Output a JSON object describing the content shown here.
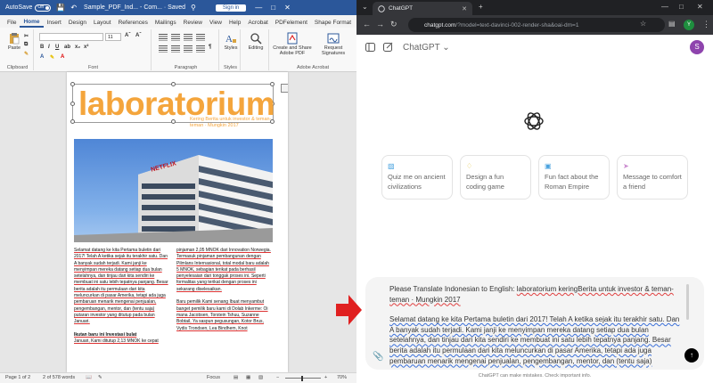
{
  "word": {
    "autosave_label": "AutoSave",
    "autosave_state": "Off",
    "doc_title": "Sample_PDF_Ind... - Com... · Saved",
    "signin_label": "Sign in",
    "tabs": [
      "File",
      "Home",
      "Insert",
      "Design",
      "Layout",
      "References",
      "Mailings",
      "Review",
      "View",
      "Help",
      "Acrobat",
      "PDFelement",
      "Shape Format"
    ],
    "active_tab": "Home",
    "ribbon": {
      "paste_label": "Paste",
      "clipboard_label": "Clipboard",
      "font_label": "Font",
      "paragraph_label": "Paragraph",
      "styles_label": "Styles",
      "editing_label": "Editing",
      "create_share_label": "Create and Share Adobe PDF",
      "request_sig_label": "Request Signatures",
      "adobe_label": "Adobe Acrobat",
      "font_size": "11"
    },
    "page": {
      "title_word": "laboratorium",
      "subtitle": "Kering Berita untuk investor & teman-teman · Mungkin 2017",
      "col1": "Selamat datang ke kita Pertama buletin dari 2017! Telah A ketika sejak itu terakhir satu. Dan A banyak sudah terjadi. Kami janji ke menyimpan mereka datang setiap dua bulan setelahnya, dan tinjau dari kita sendiri ke membuat ini satu lebih tepatnya panjang. Besar berita adalah itu permulaan dari kita meluncurkan di pasar Amerika, tetapi ada juga pembaruan menarik mengenai penjualan, pengembangan, mentor, dan (tentu saja) putaran investor yang ditutup pada bulan Januari.",
      "col1_heading": "Ikutan baru ini Investasi bulat",
      "col1_tail": "Januari, Kami ditutup 2,13 MNOK ke cepat",
      "col2": "pinjaman 2,05 MNOK dari Innovation Norwegia. Termasuk pinjaman pembangunan dengan Pilmlans Internasional, total modal baru adalah 5 MNOK, sebagian terikat pada berhasil penyelesaian dari tonggak proses ini. Seperti formalitas yang terikat dengan proses ini sekarang diselesaikan.",
      "col2_heading": "Baru pemilik Kami senang Ibuat menyambut banget pemilik baru kami di Dolab Inkerme: Oi mana Jacobsen, Torstein Tshuu, Suzanne Bobtail, Ya saspun pegusungan, Kotor Brus, Vydis Trondsen, Lea Bindhem, Knot",
      "photo_sign": "NETFLIX"
    },
    "status": {
      "page": "Page 1 of 2",
      "words": "2 of 578 words",
      "focus": "Focus",
      "zoom": "70%"
    }
  },
  "chrome": {
    "tab_title": "ChatGPT",
    "url_host": "chatgpt.com",
    "url_path": "/?model=text-davinci-002-render-sha&oai-dm=1",
    "profile_initial": "Y"
  },
  "chatgpt": {
    "title": "ChatGPT ⌄",
    "user_initial": "S",
    "cards": [
      {
        "icon": "▧",
        "color": "#4aa3df",
        "text": "Quiz me on ancient civilizations"
      },
      {
        "icon": "♢",
        "color": "#e2c541",
        "text": "Design a fun coding game"
      },
      {
        "icon": "▣",
        "color": "#4aa3df",
        "text": "Fun fact about the Roman Empire"
      },
      {
        "icon": "➤",
        "color": "#cb8bd0",
        "text": "Message to comfort a friend"
      }
    ],
    "prompt_line1_prefix": "Please Translate Indonesian to English: ",
    "prompt_line1_body": "laboratorium keringBerita untuk investor & teman-teman · Mungkin 2017",
    "prompt_para2": "Selamat datang ke kita Pertama buletin dari 2017! Telah A ketika sejak itu terakhir satu. Dan A banyak sudah terjadi. Kami janji ke menyimpan mereka datang setiap dua bulan setelahnya, dan tinjau dari kita sendiri ke membuat ini satu lebih tepatnya panjang. Besar berita adalah itu permulaan dari kita meluncurkan di pasar Amerika, tetapi ada juga pembaruan menarik mengenai penjualan, pengembangan, mentor, dan (tentu saja)",
    "disclaimer": "ChatGPT can make mistakes. Check important info."
  },
  "colors": {
    "word_blue": "#2b579a",
    "title_orange": "#f4a53c",
    "arrow_red": "#e02020"
  }
}
